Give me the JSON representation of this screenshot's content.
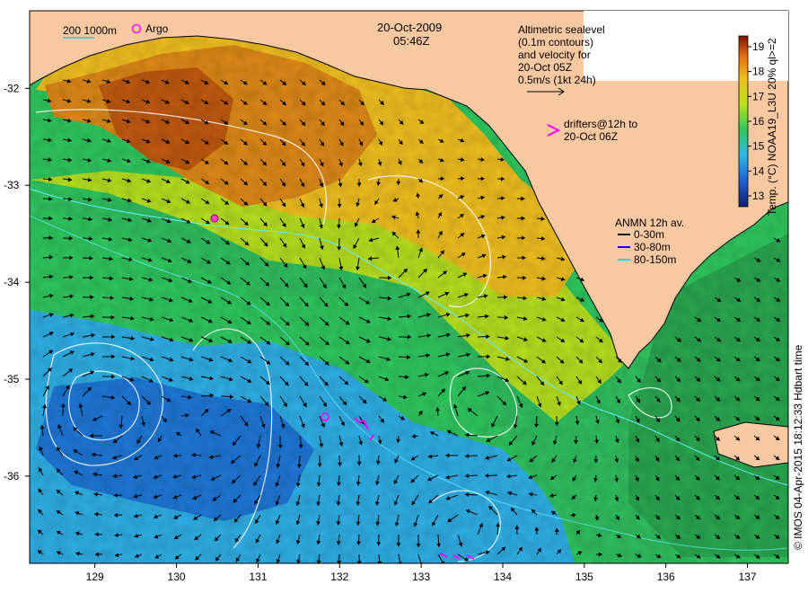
{
  "title": {
    "date": "20-Oct-2009",
    "time": "05:46Z"
  },
  "scale_legend": {
    "text": "200  1000m"
  },
  "argo_legend": {
    "text": "Argo"
  },
  "altimetry_note": {
    "line1": "Altimetric sealevel",
    "line2": "(0.1m contours)",
    "line3": "and velocity for",
    "line4": "20-Oct 05Z",
    "line5": "0.5m/s (1kt 24h)"
  },
  "drifters_note": {
    "line1": "drifters@12h to",
    "line2": "20-Oct 06Z"
  },
  "anmn_legend": {
    "title": "ANMN 12h av.",
    "items": [
      {
        "label": "0-30m",
        "color": "#000000"
      },
      {
        "label": "30-80m",
        "color": "#0000ff"
      },
      {
        "label": "80-150m",
        "color": "#00dddd"
      }
    ]
  },
  "colorbar": {
    "label": "Temp. (°C) NOAA19_L3U 20% ql>=2",
    "ticks": [
      "13",
      "14",
      "15",
      "16",
      "17",
      "18",
      "19"
    ]
  },
  "credit": "© IMOS 04-Apr-2015 18:12:33 Hdbart time",
  "axes": {
    "lon_ticks": [
      "129",
      "130",
      "131",
      "132",
      "133",
      "134",
      "135",
      "136",
      "137"
    ],
    "lat_ticks": [
      "-32",
      "-33",
      "-34",
      "-35",
      "-36"
    ],
    "lon_range": [
      128.2,
      137.5
    ],
    "lat_range": [
      -36.9,
      -31.2
    ]
  },
  "colors": {
    "land": "#f8c8a0",
    "cold": "#1a3aa8",
    "cool": "#30b0e8",
    "mid": "#30c860",
    "warm": "#e8c020",
    "hot": "#c05010"
  }
}
